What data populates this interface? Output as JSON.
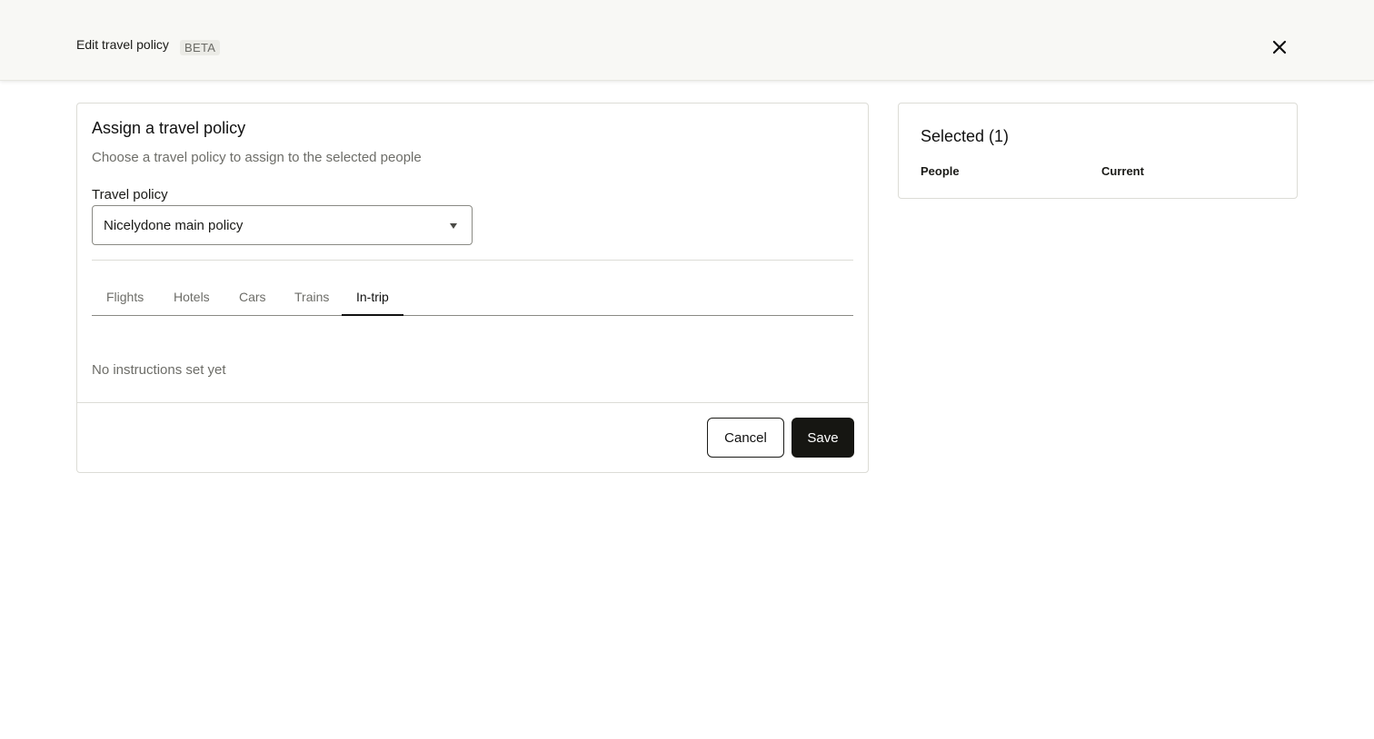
{
  "header": {
    "title": "Edit travel policy",
    "badge": "BETA",
    "close_icon": "close-icon"
  },
  "assign": {
    "title": "Assign a travel policy",
    "subtitle": "Choose a travel policy to assign to the selected people",
    "field_label": "Travel policy",
    "selected_policy": "Nicelydone main policy",
    "tabs": [
      {
        "label": "Flights",
        "active": false
      },
      {
        "label": "Hotels",
        "active": false
      },
      {
        "label": "Cars",
        "active": false
      },
      {
        "label": "Trains",
        "active": false
      },
      {
        "label": "In-trip",
        "active": true
      }
    ],
    "empty_message": "No instructions set yet",
    "cancel_label": "Cancel",
    "save_label": "Save"
  },
  "selected": {
    "title": "Selected (1)",
    "columns": [
      "People",
      "Current"
    ]
  },
  "colors": {
    "header_bg": "#f8f8f5",
    "primary_button": "#161612",
    "muted_text": "#6d6d68"
  }
}
